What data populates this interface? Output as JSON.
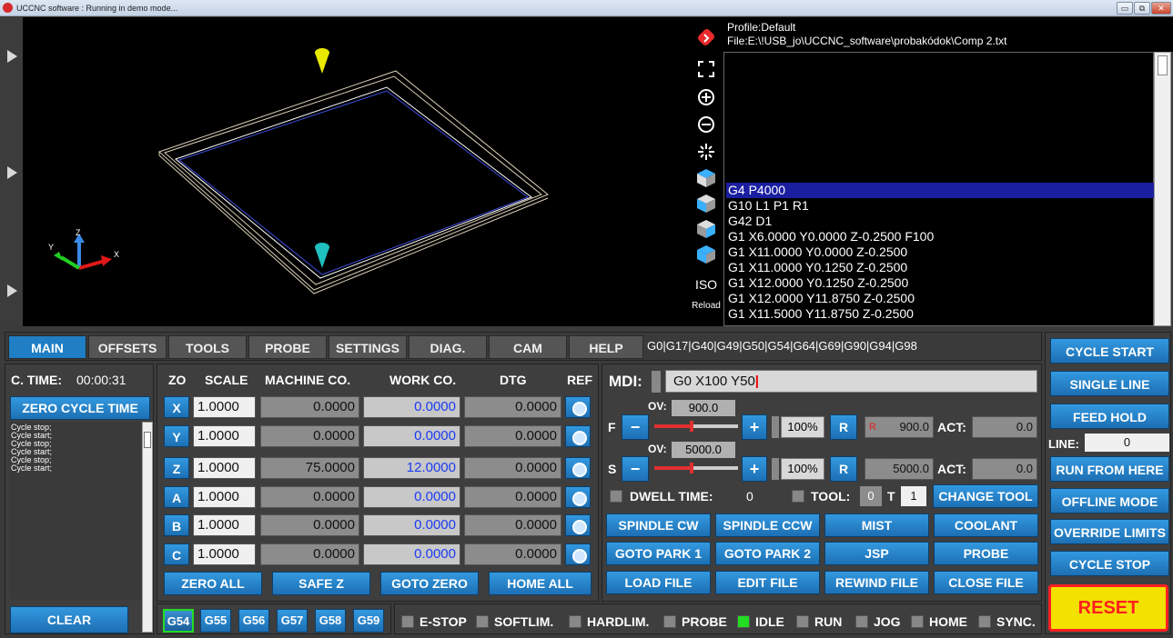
{
  "window": {
    "title": "UCCNC software : Running in demo mode...",
    "min": "▭",
    "max": "⧉",
    "close": "✕"
  },
  "code": {
    "profile": "Profile:Default",
    "file": "File:E:\\!USB_jo\\UCCNC_software\\probakódok\\Comp 2.txt",
    "lines": [
      "G4 P4000",
      "G10 L1 P1 R1",
      "G42 D1",
      "G1 X6.0000 Y0.0000 Z-0.2500 F100",
      "G1 X11.0000 Y0.0000 Z-0.2500",
      "G1 X11.0000 Y0.1250 Z-0.2500",
      "G1 X12.0000 Y0.1250 Z-0.2500",
      "G1 X12.0000 Y11.8750 Z-0.2500",
      "G1 X11.5000 Y11.8750 Z-0.2500"
    ]
  },
  "view_icons": {
    "iso": "ISO",
    "reload": "Reload"
  },
  "tabs": [
    "MAIN",
    "OFFSETS",
    "TOOLS",
    "PROBE",
    "SETTINGS",
    "DIAG.",
    "CAM",
    "HELP"
  ],
  "modal_codes": "G0|G17|G40|G49|G50|G54|G64|G69|G90|G94|G98",
  "left": {
    "ctime_label": "C. TIME:",
    "ctime_value": "00:00:31",
    "zero_cycle": "ZERO CYCLE TIME",
    "messages": [
      "Cycle stop;",
      "Cycle start;",
      "Cycle stop;",
      "Cycle start;",
      "Cycle stop;",
      "Cycle start;"
    ],
    "clear": "CLEAR"
  },
  "dro": {
    "headers": {
      "zo": "ZO",
      "scale": "SCALE",
      "machine": "MACHINE CO.",
      "work": "WORK CO.",
      "dtg": "DTG",
      "ref": "REF"
    },
    "axes": [
      {
        "name": "X",
        "scale": "1.0000",
        "machine": "0.0000",
        "work": "0.0000",
        "dtg": "0.0000"
      },
      {
        "name": "Y",
        "scale": "1.0000",
        "machine": "0.0000",
        "work": "0.0000",
        "dtg": "0.0000"
      },
      {
        "name": "Z",
        "scale": "1.0000",
        "machine": "75.0000",
        "work": "12.0000",
        "dtg": "0.0000"
      },
      {
        "name": "A",
        "scale": "1.0000",
        "machine": "0.0000",
        "work": "0.0000",
        "dtg": "0.0000"
      },
      {
        "name": "B",
        "scale": "1.0000",
        "machine": "0.0000",
        "work": "0.0000",
        "dtg": "0.0000"
      },
      {
        "name": "C",
        "scale": "1.0000",
        "machine": "0.0000",
        "work": "0.0000",
        "dtg": "0.0000"
      }
    ],
    "zero_all": "ZERO ALL",
    "safe_z": "SAFE Z",
    "goto_zero": "GOTO ZERO",
    "home_all": "HOME ALL"
  },
  "offsets": [
    "G54",
    "G55",
    "G56",
    "G57",
    "G58",
    "G59"
  ],
  "mdi": {
    "label": "MDI:",
    "value": "G0 X100 Y50"
  },
  "feed": {
    "label": "F",
    "ov_label": "OV:",
    "ov": "900.0",
    "minus": "−",
    "plus": "+",
    "pct": "100%",
    "r": "R",
    "r_mark": "R",
    "value": "900.0",
    "act_label": "ACT:",
    "act": "0.0",
    "slider": 0.45
  },
  "spindle": {
    "label": "S",
    "ov_label": "OV:",
    "ov": "5000.0",
    "minus": "−",
    "plus": "+",
    "pct": "100%",
    "r": "R",
    "value": "5000.0",
    "act_label": "ACT:",
    "act": "0.0",
    "slider": 0.45
  },
  "dwell": {
    "label": "DWELL TIME:",
    "value": "0"
  },
  "tool": {
    "label": "TOOL:",
    "value": "0",
    "t_label": "T",
    "t_value": "1",
    "change": "CHANGE TOOL"
  },
  "buttons": [
    [
      "SPINDLE CW",
      "SPINDLE CCW",
      "MIST",
      "COOLANT"
    ],
    [
      "GOTO PARK 1",
      "GOTO PARK 2",
      "JSP",
      "PROBE"
    ],
    [
      "LOAD FILE",
      "EDIT FILE",
      "REWIND FILE",
      "CLOSE FILE"
    ]
  ],
  "status": [
    "E-STOP",
    "SOFTLIM.",
    "HARDLIM.",
    "PROBE",
    "IDLE",
    "RUN",
    "JOG",
    "HOME",
    "SYNC."
  ],
  "right": {
    "cycle_start": "CYCLE START",
    "single_line": "SINGLE LINE",
    "feed_hold": "FEED HOLD",
    "line_label": "LINE:",
    "line_value": "0",
    "run_from_here": "RUN FROM HERE",
    "offline_mode": "OFFLINE MODE",
    "override_limits": "OVERRIDE LIMITS",
    "cycle_stop": "CYCLE STOP",
    "reset": "RESET"
  },
  "axis_labels": {
    "z": "Z",
    "x": "X",
    "y": "Y"
  },
  "colors": {
    "accent": "#1f7ec4",
    "selected_line": "#1a1fa0",
    "led_on": "#22dd22",
    "reset": "#ff2020"
  }
}
